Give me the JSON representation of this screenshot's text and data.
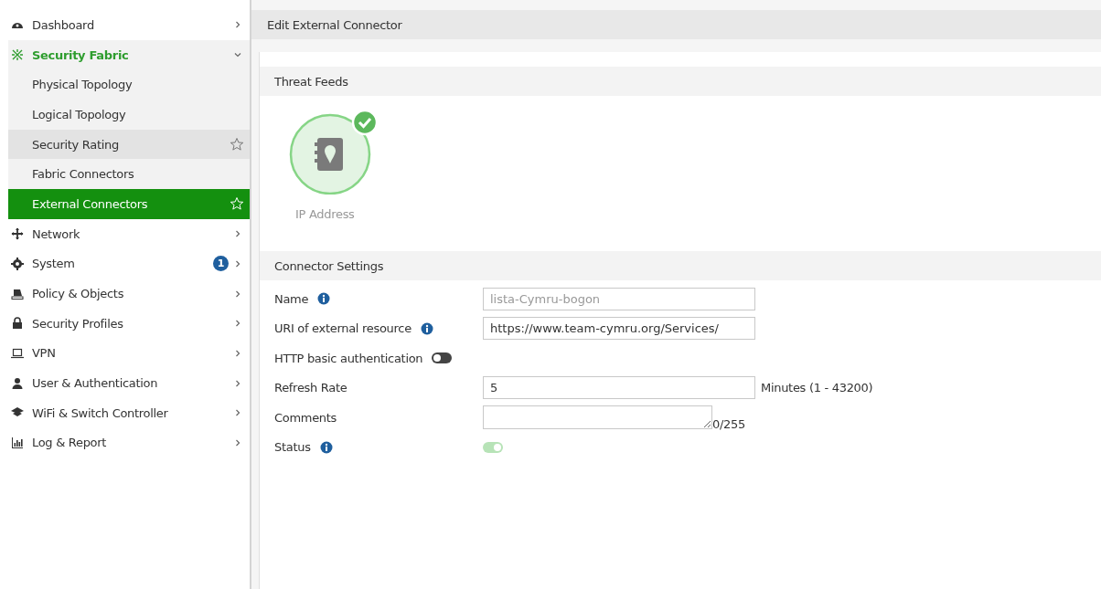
{
  "sidebar": {
    "items": [
      {
        "label": "Dashboard",
        "expanded": false,
        "selected": false
      },
      {
        "label": "Security Fabric",
        "expanded": true,
        "selected": true,
        "children": [
          {
            "label": "Physical Topology",
            "selected": false,
            "hovered": false
          },
          {
            "label": "Logical Topology",
            "selected": false,
            "hovered": false
          },
          {
            "label": "Security Rating",
            "selected": false,
            "hovered": true
          },
          {
            "label": "Fabric Connectors",
            "selected": false,
            "hovered": false
          },
          {
            "label": "External Connectors",
            "selected": true,
            "hovered": false
          }
        ]
      },
      {
        "label": "Network",
        "expanded": false,
        "selected": false
      },
      {
        "label": "System",
        "expanded": false,
        "selected": false,
        "badge": "1"
      },
      {
        "label": "Policy & Objects",
        "expanded": false,
        "selected": false
      },
      {
        "label": "Security Profiles",
        "expanded": false,
        "selected": false
      },
      {
        "label": "VPN",
        "expanded": false,
        "selected": false
      },
      {
        "label": "User & Authentication",
        "expanded": false,
        "selected": false
      },
      {
        "label": "WiFi & Switch Controller",
        "expanded": false,
        "selected": false
      },
      {
        "label": "Log & Report",
        "expanded": false,
        "selected": false
      }
    ]
  },
  "page": {
    "title": "Edit External Connector"
  },
  "threat_feeds": {
    "title": "Threat Feeds",
    "feed": {
      "label": "IP Address",
      "checked": true
    }
  },
  "connector_settings": {
    "title": "Connector Settings",
    "fields": [
      {
        "kind": "text",
        "label": "Name",
        "info": true,
        "value": "lista-Cymru-bogon",
        "disabled": true
      },
      {
        "kind": "text",
        "label": "URI of external resource",
        "info": true,
        "value": "https://www.team-cymru.org/Services/",
        "disabled": false
      },
      {
        "kind": "toggle",
        "label": "HTTP basic authentication",
        "info": false,
        "on": false,
        "disabled": false
      },
      {
        "kind": "text",
        "label": "Refresh Rate",
        "info": false,
        "value": "5",
        "disabled": false,
        "suffix": "Minutes (1 - 43200)"
      },
      {
        "kind": "textarea",
        "label": "Comments",
        "info": false,
        "counter": "0/255"
      },
      {
        "kind": "toggle",
        "label": "Status",
        "info": true,
        "on": true,
        "disabled": true
      }
    ]
  }
}
